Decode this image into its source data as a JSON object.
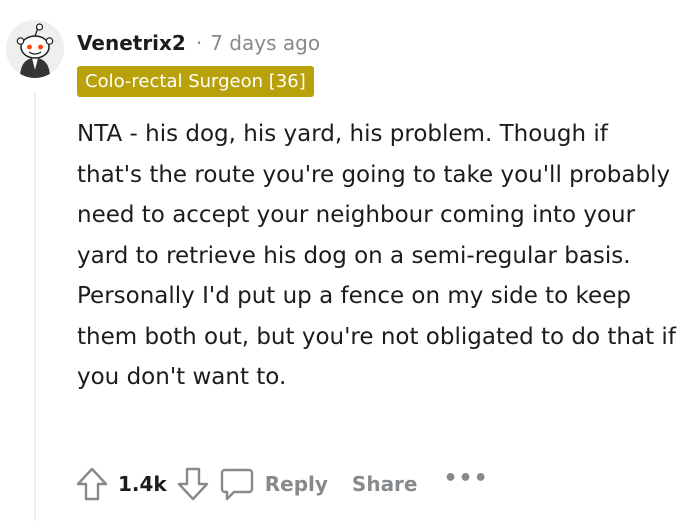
{
  "comment": {
    "username": "Venetrix2",
    "separator": "·",
    "timestamp": "7 days ago",
    "flair": "Colo-rectal Surgeon [36]",
    "body": "NTA - his dog, his yard, his problem. Though if that's the route you're going to take you'll probably need to accept your neighbour coming into your yard to retrieve his dog on a semi-regular basis. Personally I'd put up a fence on my side to keep them both out, but you're not obligated to do that if you don't want to.",
    "score": "1.4k",
    "reply_label": "Reply",
    "share_label": "Share",
    "more_label": "•••"
  },
  "colors": {
    "flair_background": "#b8a10a",
    "muted_text": "#878a8c",
    "text": "#1c1c1c"
  },
  "icons": {
    "avatar": "snoo-avatar",
    "upvote": "upvote-arrow-icon",
    "downvote": "downvote-arrow-icon",
    "reply": "speech-bubble-icon",
    "more": "more-options-icon"
  }
}
